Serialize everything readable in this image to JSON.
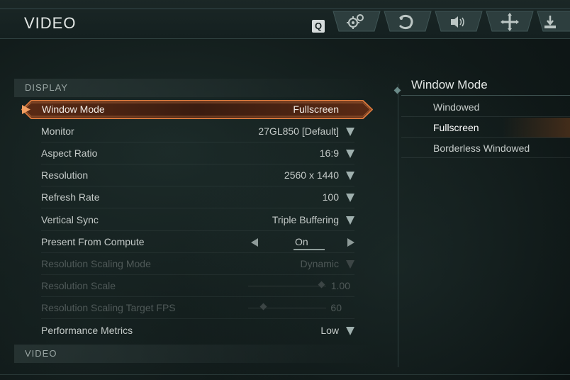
{
  "header": {
    "title": "VIDEO",
    "q_key": "Q",
    "tabs": [
      {
        "icon": "gears-icon"
      },
      {
        "icon": "controller-icon"
      },
      {
        "icon": "speaker-icon"
      },
      {
        "icon": "crosshair-icon"
      },
      {
        "icon": "download-icon"
      }
    ]
  },
  "sections": {
    "display": "DISPLAY",
    "video": "VIDEO"
  },
  "settings": [
    {
      "label": "Window Mode",
      "value": "Fullscreen"
    },
    {
      "label": "Monitor",
      "value": "27GL850 [Default]"
    },
    {
      "label": "Aspect Ratio",
      "value": "16:9"
    },
    {
      "label": "Resolution",
      "value": "2560 x 1440"
    },
    {
      "label": "Refresh Rate",
      "value": "100"
    },
    {
      "label": "Vertical Sync",
      "value": "Triple Buffering"
    },
    {
      "label": "Present From Compute",
      "value": "On"
    },
    {
      "label": "Resolution Scaling Mode",
      "value": "Dynamic"
    },
    {
      "label": "Resolution Scale",
      "value": "1.00"
    },
    {
      "label": "Resolution Scaling Target FPS",
      "value": "60"
    },
    {
      "label": "Performance Metrics",
      "value": "Low"
    }
  ],
  "panel": {
    "title": "Window Mode",
    "options": [
      "Windowed",
      "Fullscreen",
      "Borderless Windowed"
    ],
    "selected": "Fullscreen"
  },
  "colors": {
    "accent": "#c8622a",
    "background": "#121c1b"
  }
}
